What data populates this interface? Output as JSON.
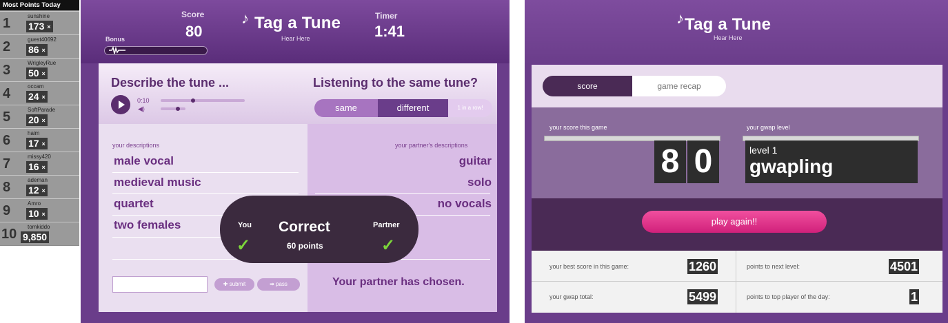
{
  "leaderboard": {
    "title": "Most Points Today",
    "rows": [
      {
        "rank": "1",
        "user": "sunshine",
        "points": "173"
      },
      {
        "rank": "2",
        "user": "guest40692",
        "points": "86"
      },
      {
        "rank": "3",
        "user": "WrigleyRue",
        "points": "50"
      },
      {
        "rank": "4",
        "user": "occam",
        "points": "24"
      },
      {
        "rank": "5",
        "user": "SoftParade",
        "points": "20"
      },
      {
        "rank": "6",
        "user": "haim",
        "points": "17"
      },
      {
        "rank": "7",
        "user": "missy420",
        "points": "16"
      },
      {
        "rank": "8",
        "user": "ademan",
        "points": "12"
      },
      {
        "rank": "9",
        "user": "Amro",
        "points": "10"
      },
      {
        "rank": "10",
        "user": "tomkiddo",
        "points": "9,850"
      }
    ],
    "multiplier": "×"
  },
  "game": {
    "score_label": "Score",
    "score": "80",
    "timer_label": "Timer",
    "timer": "1:41",
    "bonus_label": "Bonus",
    "logo": "Tag a Tune",
    "logo_sub": "Hear Here",
    "describe_title": "Describe the tune ...",
    "player_time": "0:10",
    "listening_title": "Listening to the same tune?",
    "same_label": "same",
    "different_label": "different",
    "inarow_label": "1 in a row!",
    "your_desc_label": "your descriptions",
    "partner_desc_label": "your partner's descriptions",
    "your_descriptions": [
      "male vocal",
      "medieval music",
      "quartet",
      "two females"
    ],
    "partner_descriptions": [
      "guitar",
      "solo",
      "no vocals"
    ],
    "overlay": {
      "you": "You",
      "partner": "Partner",
      "result": "Correct",
      "points": "60 points"
    },
    "submit_label": "submit",
    "pass_label": "pass",
    "partner_status": "Your partner has chosen."
  },
  "recap": {
    "logo": "Tag a Tune",
    "logo_sub": "Hear Here",
    "tab_score": "score",
    "tab_recap": "game recap",
    "score_label": "your score this game",
    "score": "80",
    "level_label": "your gwap level",
    "level_line": "level 1",
    "level_name": "gwapling",
    "play_again": "play again!!",
    "stats": [
      {
        "label": "your best score in this game:",
        "value": "1260"
      },
      {
        "label": "points to next level:",
        "value": "4501"
      },
      {
        "label": "your gwap total:",
        "value": "5499"
      },
      {
        "label": "points to top player of the day:",
        "value": "1"
      }
    ]
  }
}
